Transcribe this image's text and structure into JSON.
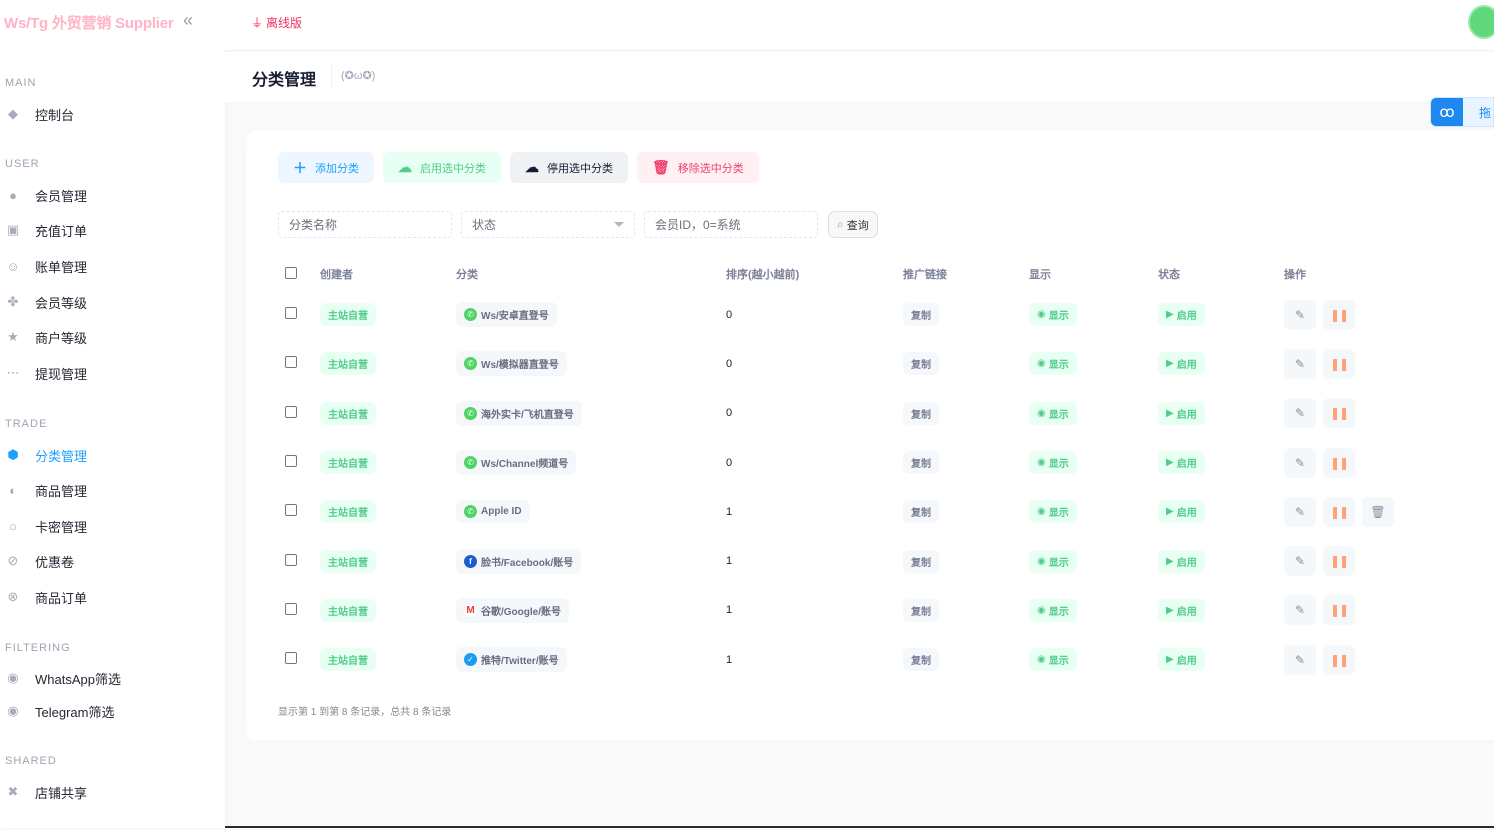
{
  "sidebar": {
    "brand": "Ws/Tg 外贸营销 Supplier",
    "collapse_icon": "double-chevron-left-icon",
    "sections": [
      {
        "title": "MAIN",
        "items": [
          {
            "label": "控制台",
            "icon": "dashboard-icon"
          }
        ]
      },
      {
        "title": "USER",
        "items": [
          {
            "label": "会员管理",
            "icon": "user-icon"
          },
          {
            "label": "充值订单",
            "icon": "wallet-icon"
          },
          {
            "label": "账单管理",
            "icon": "face-scan-icon"
          },
          {
            "label": "会员等级",
            "icon": "fan-icon"
          },
          {
            "label": "商户等级",
            "icon": "star-icon"
          },
          {
            "label": "提现管理",
            "icon": "dots-icon"
          }
        ]
      },
      {
        "title": "TRADE",
        "items": [
          {
            "label": "分类管理",
            "icon": "category-icon",
            "active": true
          },
          {
            "label": "商品管理",
            "icon": "product-icon"
          },
          {
            "label": "卡密管理",
            "icon": "gear-circle-icon"
          },
          {
            "label": "优惠卷",
            "icon": "coupon-icon"
          },
          {
            "label": "商品订单",
            "icon": "order-icon"
          }
        ]
      },
      {
        "title": "FILTERING",
        "items": [
          {
            "label": "WhatsApp筛选",
            "icon": "send-icon"
          },
          {
            "label": "Telegram筛选",
            "icon": "send-icon"
          }
        ]
      },
      {
        "title": "SHARED",
        "items": [
          {
            "label": "店铺共享",
            "icon": "share-cross-icon"
          }
        ]
      }
    ]
  },
  "topbar": {
    "offline_label": "离线版",
    "offline_icon": "plug-icon"
  },
  "header": {
    "title": "分类管理",
    "subtitle": "(✪ω✪)"
  },
  "float_tool": {
    "label": "拖"
  },
  "toolbar": {
    "add_label": "添加分类",
    "enable_label": "启用选中分类",
    "disable_label": "停用选中分类",
    "remove_label": "移除选中分类"
  },
  "filters": {
    "name_placeholder": "分类名称",
    "status_placeholder": "状态",
    "member_placeholder": "会员ID，0=系统",
    "query_label": "查询"
  },
  "table": {
    "columns": [
      "创建者",
      "分类",
      "排序(越小越前)",
      "推广链接",
      "显示",
      "状态",
      "操作"
    ],
    "rows": [
      {
        "creator": "主站自营",
        "category": "Ws/安卓直登号",
        "icon": "whatsapp",
        "sort": "0",
        "link": "复制",
        "show": "显示",
        "status": "启用",
        "deletable": false
      },
      {
        "creator": "主站自营",
        "category": "Ws/模拟器直登号",
        "icon": "whatsapp",
        "sort": "0",
        "link": "复制",
        "show": "显示",
        "status": "启用",
        "deletable": false
      },
      {
        "creator": "主站自营",
        "category": "海外实卡/飞机直登号",
        "icon": "whatsapp",
        "sort": "0",
        "link": "复制",
        "show": "显示",
        "status": "启用",
        "deletable": false
      },
      {
        "creator": "主站自营",
        "category": "Ws/Channel频道号",
        "icon": "whatsapp",
        "sort": "0",
        "link": "复制",
        "show": "显示",
        "status": "启用",
        "deletable": false
      },
      {
        "creator": "主站自营",
        "category": "Apple ID",
        "icon": "whatsapp",
        "sort": "1",
        "link": "复制",
        "show": "显示",
        "status": "启用",
        "deletable": true
      },
      {
        "creator": "主站自营",
        "category": "脸书/Facebook/账号",
        "icon": "facebook",
        "sort": "1",
        "link": "复制",
        "show": "显示",
        "status": "启用",
        "deletable": false
      },
      {
        "creator": "主站自营",
        "category": "谷歌/Google/账号",
        "icon": "gmail",
        "sort": "1",
        "link": "复制",
        "show": "显示",
        "status": "启用",
        "deletable": false
      },
      {
        "creator": "主站自营",
        "category": "推特/Twitter/账号",
        "icon": "twitter",
        "sort": "1",
        "link": "复制",
        "show": "显示",
        "status": "启用",
        "deletable": false
      }
    ]
  },
  "pager": {
    "summary": "显示第 1 到第 8 条记录，总共 8 条记录"
  }
}
